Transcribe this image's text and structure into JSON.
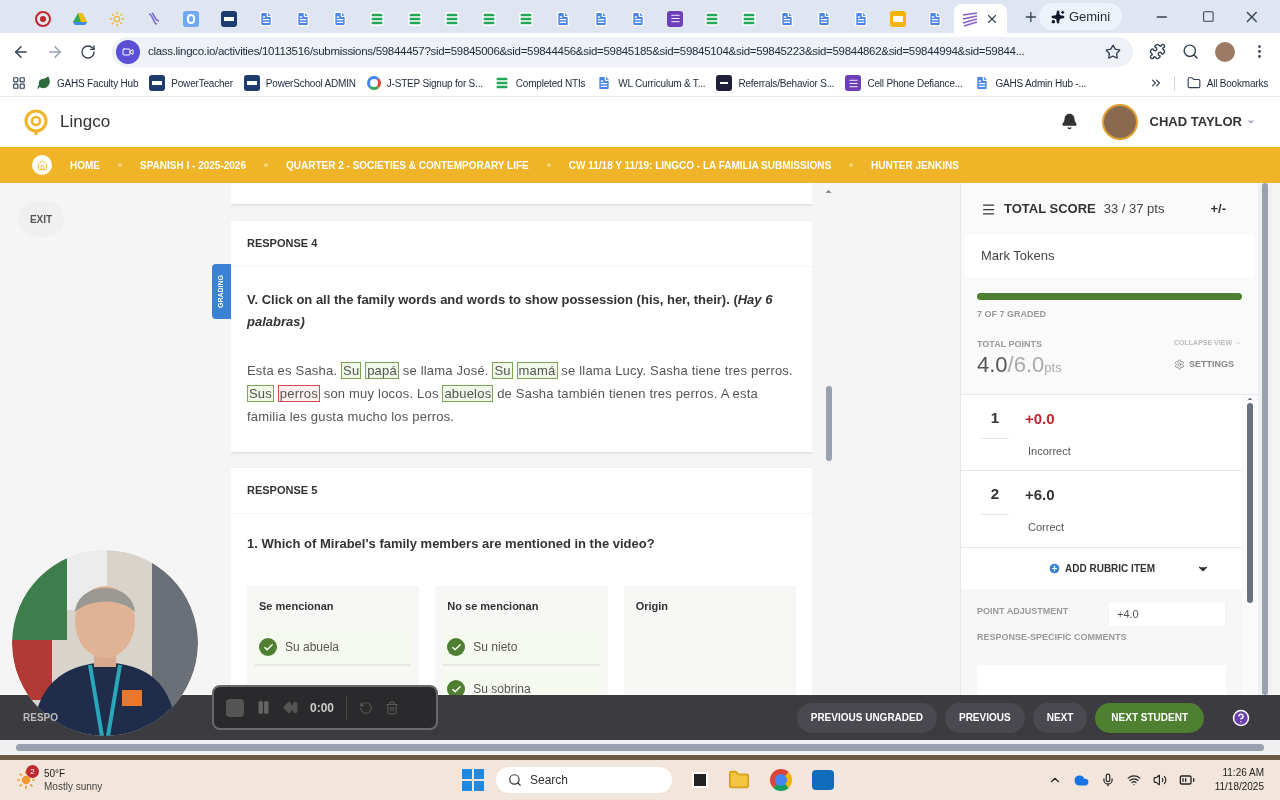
{
  "browser": {
    "tabs": [
      {
        "kind": "record",
        "selected": false
      },
      {
        "kind": "drive",
        "selected": false
      },
      {
        "kind": "sun",
        "selected": false
      },
      {
        "kind": "wave",
        "selected": false
      },
      {
        "kind": "letter",
        "selected": false
      },
      {
        "kind": "sis",
        "selected": false
      },
      {
        "kind": "doc",
        "selected": false
      },
      {
        "kind": "doc",
        "selected": false
      },
      {
        "kind": "doc",
        "selected": false
      },
      {
        "kind": "sheet",
        "selected": false
      },
      {
        "kind": "sheet",
        "selected": false
      },
      {
        "kind": "sheet",
        "selected": false
      },
      {
        "kind": "sheet",
        "selected": false
      },
      {
        "kind": "sheet",
        "selected": false
      },
      {
        "kind": "doc",
        "selected": false
      },
      {
        "kind": "doc",
        "selected": false
      },
      {
        "kind": "doc",
        "selected": false
      },
      {
        "kind": "form",
        "selected": false
      },
      {
        "kind": "sheet",
        "selected": false
      },
      {
        "kind": "sheet",
        "selected": false
      },
      {
        "kind": "doc",
        "selected": false
      },
      {
        "kind": "doc",
        "selected": false
      },
      {
        "kind": "doc",
        "selected": false
      },
      {
        "kind": "slides",
        "selected": false
      },
      {
        "kind": "doc",
        "selected": false
      },
      {
        "kind": "pattern",
        "selected": true
      }
    ],
    "gemini": "Gemini",
    "url": "class.lingco.io/activities/10113516/submissions/59844457?sid=59845006&sid=59844456&sid=59845185&sid=59845104&sid=59845223&sid=59844862&sid=59844994&sid=59844...",
    "bookmarks": [
      {
        "label": "GAHS Faculty Hub",
        "kind": "leaf"
      },
      {
        "label": "PowerTeacher",
        "kind": "sis"
      },
      {
        "label": "PowerSchool ADMIN",
        "kind": "sis"
      },
      {
        "label": "J-STEP Signup for S...",
        "kind": "google"
      },
      {
        "label": "Completed NTIs",
        "kind": "sheet"
      },
      {
        "label": "WL Curriculum & T...",
        "kind": "doc"
      },
      {
        "label": "Referrals/Behavior S...",
        "kind": "dark"
      },
      {
        "label": "Cell Phone Defiance...",
        "kind": "form"
      },
      {
        "label": "GAHS Admin Hub -...",
        "kind": "doc"
      }
    ],
    "all_bookmarks": "All Bookmarks"
  },
  "app": {
    "logo": "Lingco",
    "user": "CHAD TAYLOR",
    "breadcrumbs": [
      "HOME",
      "SPANISH I - 2025-2026",
      "QUARTER 2 - SOCIETIES & CONTEMPORARY LIFE",
      "CW 11/18 Y 11/19: LINGCO - LA FAMILIA SUBMISSIONS",
      "HUNTER JENKINS"
    ],
    "exit": "EXIT",
    "side_tab": "GRADING",
    "responses": [
      {
        "kind": "tokens",
        "title": "RESPONSE 4",
        "question": "V.  Click on all the family words and words to show possession (his, her, their). (*Hay 6 palabras)*",
        "passage": [
          {
            "text": "Esta es Sasha.",
            "kind": "plain"
          },
          {
            "text": "Su",
            "kind": "correct"
          },
          {
            "text": "papá",
            "kind": "correct"
          },
          {
            "text": "se llama José.",
            "kind": "plain"
          },
          {
            "text": "Su",
            "kind": "correct"
          },
          {
            "text": "mamá",
            "kind": "correct"
          },
          {
            "text": "se llama Lucy. Sasha tiene tres perros.",
            "kind": "plain"
          },
          {
            "text": "Sus",
            "kind": "correct"
          },
          {
            "text": "perros",
            "kind": "incorrect"
          },
          {
            "text": "son muy locos. Los",
            "kind": "plain"
          },
          {
            "text": "abuelos",
            "kind": "correct"
          },
          {
            "text": "de Sasha también tienen tres perros. A esta familia les gusta mucho los perros.",
            "kind": "plain"
          }
        ]
      },
      {
        "kind": "categorize",
        "title": "RESPONSE 5",
        "question": "1. Which of Mirabel's family members are mentioned in the video?",
        "columns": [
          {
            "title": "Se mencionan",
            "items": [
              {
                "text": "Su abuela",
                "correct": true
              }
            ]
          },
          {
            "title": "No se mencionan",
            "items": [
              {
                "text": "Su nieto",
                "correct": true
              },
              {
                "text": "Su sobrina",
                "correct": true
              }
            ]
          },
          {
            "title": "Origin"
          }
        ]
      }
    ],
    "panel": {
      "score_label": "TOTAL SCORE",
      "score": "33 / 37 pts",
      "adjust": "+/-",
      "section": "Mark Tokens",
      "progress": {
        "level": 1.0
      },
      "graded": "7 OF 7 GRADED",
      "points_label": "TOTAL POINTS",
      "collapse": "COLLAPSE VIEW",
      "points": "4.0",
      "points_max": "/6.0",
      "points_unit": "pts",
      "settings": "SETTINGS",
      "rubric": [
        {
          "number": "1",
          "points": "+0.0",
          "label": "Incorrect",
          "color": "#c0262d"
        },
        {
          "number": "2",
          "points": "+6.0",
          "label": "Correct",
          "color": "#333333"
        }
      ],
      "add_rubric": "ADD RUBRIC ITEM",
      "adjustment_label": "POINT ADJUSTMENT",
      "adjustment": "+4.0",
      "comments_label": "RESPONSE-SPECIFIC COMMENTS"
    },
    "footer": {
      "response_label": "RESPO",
      "buttons": [
        {
          "label": "PREVIOUS UNGRADED",
          "kind": "secondary"
        },
        {
          "label": "PREVIOUS",
          "kind": "secondary"
        },
        {
          "label": "NEXT",
          "kind": "secondary"
        },
        {
          "label": "NEXT STUDENT",
          "kind": "primary"
        }
      ]
    },
    "recorder": {
      "time": "0:00"
    }
  },
  "taskbar": {
    "badge": "2",
    "temperature": "50°F",
    "weather": "Mostly sunny",
    "search": "Search",
    "time": "11:26 AM",
    "date": "11/18/2025"
  }
}
